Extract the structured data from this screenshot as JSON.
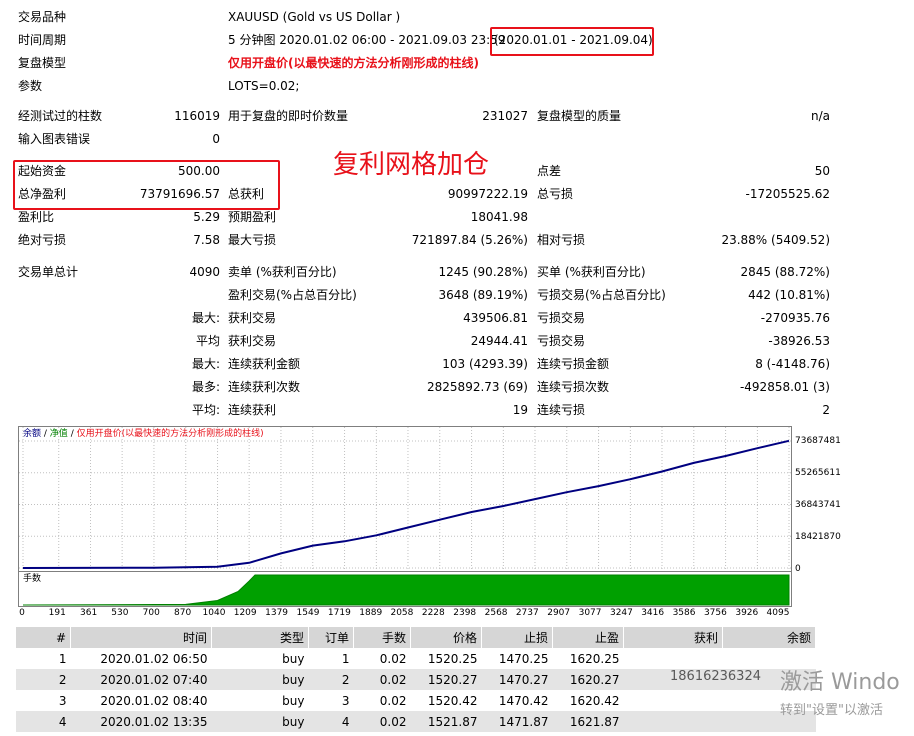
{
  "settings": {
    "symbol_label": "交易品种",
    "symbol_value": "XAUUSD (Gold vs US Dollar )",
    "period_label": "时间周期",
    "period_value": "5 分钟图 2020.01.02 06:00 - 2021.09.03 23:59",
    "period_range": "(2020.01.01 - 2021.09.04)",
    "model_label": "复盘模型",
    "model_value": "仅用开盘价(以最快速的方法分析刚形成的柱线)",
    "params_label": "参数",
    "params_value": "LOTS=0.02;"
  },
  "stats": {
    "bars_tested_label": "经测试过的柱数",
    "bars_tested": "116019",
    "ticks_label": "用于复盘的即时价数量",
    "ticks": "231027",
    "quality_label": "复盘模型的质量",
    "quality": "n/a",
    "mismatch_label": "输入图表错误",
    "mismatch": "0",
    "deposit_label": "起始资金",
    "deposit": "500.00",
    "spread_label": "点差",
    "spread": "50",
    "net_profit_label": "总净盈利",
    "net_profit": "73791696.57",
    "gross_profit_label": "总获利",
    "gross_profit": "90997222.19",
    "gross_loss_label": "总亏损",
    "gross_loss": "-17205525.62",
    "profit_factor_label": "盈利比",
    "profit_factor": "5.29",
    "expected_payoff_label": "预期盈利",
    "expected_payoff": "18041.98",
    "abs_dd_label": "绝对亏损",
    "abs_dd": "7.58",
    "max_dd_label": "最大亏损",
    "max_dd": "721897.84 (5.26%)",
    "rel_dd_label": "相对亏损",
    "rel_dd": "23.88% (5409.52)",
    "total_trades_label": "交易单总计",
    "total_trades": "4090",
    "short_label": "卖单 (%获利百分比)",
    "short": "1245 (90.28%)",
    "long_label": "买单 (%获利百分比)",
    "long": "2845 (88.72%)",
    "profit_trades_label": "盈利交易(%占总百分比)",
    "profit_trades": "3648 (89.19%)",
    "loss_trades_label": "亏损交易(%占总百分比)",
    "loss_trades": "442 (10.81%)",
    "largest_label": "最大:",
    "largest_profit_label": "获利交易",
    "largest_profit": "439506.81",
    "largest_loss_label": "亏损交易",
    "largest_loss": "-270935.76",
    "average_label": "平均",
    "avg_profit_label": "获利交易",
    "avg_profit": "24944.41",
    "avg_loss_label": "亏损交易",
    "avg_loss": "-38926.53",
    "max_cons_label": "最大:",
    "max_cons_wins_label": "连续获利金额",
    "max_cons_wins": "103 (4293.39)",
    "max_cons_losses_label": "连续亏损金额",
    "max_cons_losses": "8 (-4148.76)",
    "most_label": "最多:",
    "most_cons_profit_label": "连续获利次数",
    "most_cons_profit": "2825892.73 (69)",
    "most_cons_loss_label": "连续亏损次数",
    "most_cons_loss": "-492858.01 (3)",
    "avg_cons_label": "平均:",
    "avg_cons_wins_label": "连续获利",
    "avg_cons_wins": "19",
    "avg_cons_losses_label": "连续亏损",
    "avg_cons_losses": "2"
  },
  "annotation": "复利网格加仓",
  "chart_data": {
    "type": "line",
    "legend": {
      "balance": "余额",
      "equity": "净值",
      "note": "仅用开盘价(以最快速的方法分析刚形成的柱线)"
    },
    "y_ticks": [
      "73687481",
      "55265611",
      "36843741",
      "18421870",
      "0"
    ],
    "ylim": [
      0,
      73687481
    ],
    "xlim": [
      0,
      4095
    ],
    "x_ticks": [
      "0",
      "191",
      "361",
      "530",
      "700",
      "870",
      "1040",
      "1209",
      "1379",
      "1549",
      "1719",
      "1889",
      "2058",
      "2228",
      "2398",
      "2568",
      "2737",
      "2907",
      "3077",
      "3247",
      "3416",
      "3586",
      "3756",
      "3926",
      "4095"
    ],
    "balance_x": [
      0,
      700,
      1040,
      1209,
      1379,
      1549,
      1719,
      1889,
      2058,
      2228,
      2398,
      2568,
      2737,
      2907,
      3077,
      3247,
      3416,
      3586,
      3756,
      3926,
      4095
    ],
    "balance_y": [
      500,
      150000,
      700000,
      3000000,
      8500000,
      13000000,
      15500000,
      19000000,
      23500000,
      28000000,
      32500000,
      36000000,
      40000000,
      44000000,
      47500000,
      51500000,
      56000000,
      61000000,
      65000000,
      69500000,
      73791696
    ],
    "lots_label": "手数",
    "lots_x": [
      0,
      870,
      1040,
      1150,
      1209,
      1240,
      4095
    ],
    "lots_y": [
      0,
      0.02,
      0.15,
      0.45,
      0.8,
      1,
      1
    ]
  },
  "trades": {
    "headers": [
      "#",
      "时间",
      "类型",
      "订单",
      "手数",
      "价格",
      "止损",
      "止盈",
      "获利",
      "余额"
    ],
    "rows": [
      [
        "1",
        "2020.01.02 06:50",
        "buy",
        "1",
        "0.02",
        "1520.25",
        "1470.25",
        "1620.25",
        "",
        ""
      ],
      [
        "2",
        "2020.01.02 07:40",
        "buy",
        "2",
        "0.02",
        "1520.27",
        "1470.27",
        "1620.27",
        "",
        ""
      ],
      [
        "3",
        "2020.01.02 08:40",
        "buy",
        "3",
        "0.02",
        "1520.42",
        "1470.42",
        "1620.42",
        "",
        ""
      ],
      [
        "4",
        "2020.01.02 13:35",
        "buy",
        "4",
        "0.02",
        "1521.87",
        "1471.87",
        "1621.87",
        "",
        ""
      ]
    ]
  },
  "watermark": {
    "phone": "18616236324",
    "activate": "激活 Windo",
    "hint": "转到\"设置\"以激活"
  }
}
